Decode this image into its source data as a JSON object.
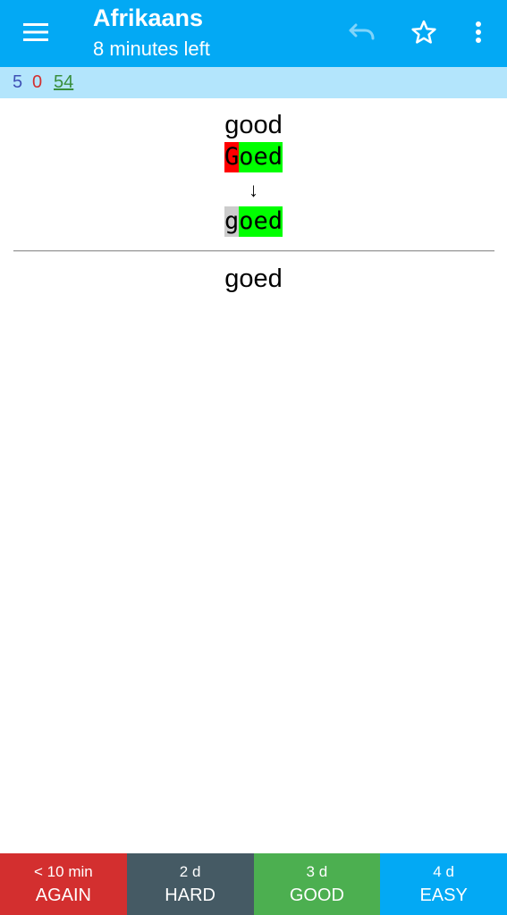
{
  "toolbar": {
    "title": "Afrikaans",
    "subtitle": "8 minutes left",
    "icons": [
      "hamburger-menu-icon",
      "undo-icon",
      "star-outline-icon",
      "more-vert-icon"
    ],
    "background": "#03a9f4"
  },
  "counts": {
    "new": "5",
    "learning": "0",
    "review": "54",
    "colors": {
      "new": "#3f51b5",
      "learning": "#d32f2f",
      "review": "#388e3c"
    },
    "background": "#b3e5fc"
  },
  "card": {
    "prompt": "good",
    "typed_wrong": "G",
    "typed_right": "oed",
    "arrow": "↓",
    "correct_missing": "g",
    "correct_matched": "oed",
    "answer": "goed",
    "colors": {
      "wrong": "#ff0000",
      "match": "#00ff00",
      "missing": "#cccccc"
    }
  },
  "buttons": [
    {
      "interval": "< 10 min",
      "label": "AGAIN",
      "color": "#d32f2f"
    },
    {
      "interval": "2 d",
      "label": "HARD",
      "color": "#455a64"
    },
    {
      "interval": "3 d",
      "label": "GOOD",
      "color": "#4caf50"
    },
    {
      "interval": "4 d",
      "label": "EASY",
      "color": "#03a9f4"
    }
  ]
}
